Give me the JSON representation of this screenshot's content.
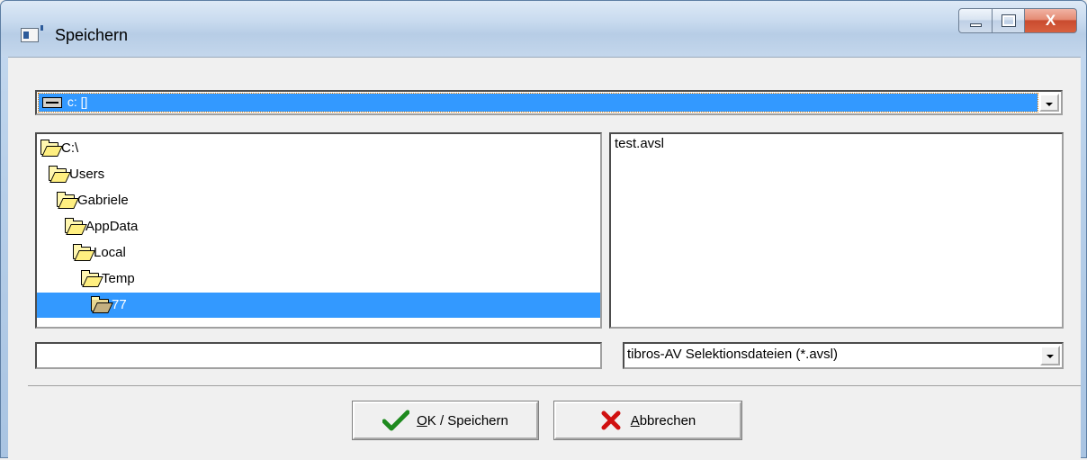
{
  "window": {
    "title": "Speichern",
    "title_icon": "app-window-icon",
    "controls": {
      "minimize_icon": "minimize-icon",
      "maximize_icon": "maximize-icon",
      "close_label": "X"
    }
  },
  "drive": {
    "selected": "c: []",
    "icon": "drive-icon"
  },
  "directories": [
    {
      "label": "C:\\",
      "level": 0,
      "selected": false
    },
    {
      "label": "Users",
      "level": 1,
      "selected": false
    },
    {
      "label": "Gabriele",
      "level": 2,
      "selected": false
    },
    {
      "label": "AppData",
      "level": 3,
      "selected": false
    },
    {
      "label": "Local",
      "level": 4,
      "selected": false
    },
    {
      "label": "Temp",
      "level": 5,
      "selected": false
    },
    {
      "label": "77",
      "level": 6,
      "selected": true
    }
  ],
  "files": [
    "test.avsl"
  ],
  "filename": {
    "value": "",
    "placeholder": ""
  },
  "filetype": {
    "selected": "tibros-AV Selektionsdateien (*.avsl)"
  },
  "buttons": {
    "ok": {
      "accel": "O",
      "rest": "K / Speichern",
      "icon": "checkmark-icon",
      "color": "#1e8a1e"
    },
    "cancel": {
      "accel": "A",
      "rest": "bbrechen",
      "icon": "red-x-icon",
      "color": "#d01010"
    }
  },
  "colors": {
    "selection": "#3399ff",
    "face": "#f0f0f0"
  }
}
